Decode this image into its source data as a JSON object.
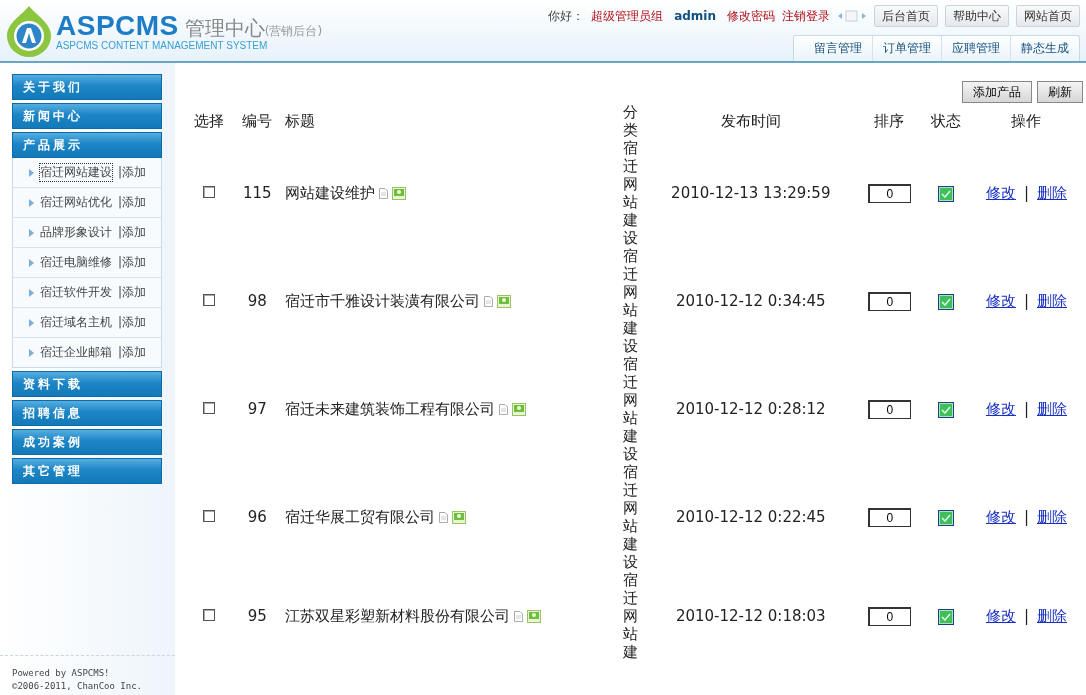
{
  "header": {
    "logo": {
      "name": "ASPCMS",
      "title": "管理中心",
      "subtitle": "(营销后台)",
      "tagline": "ASPCMS CONTENT MANAGEMENT SYSTEM"
    },
    "greeting": "你好：",
    "group": "超级管理员组",
    "username": "admin",
    "links": [
      "修改密码",
      "注销登录"
    ],
    "buttons": [
      "后台首页",
      "帮助中心",
      "网站首页"
    ],
    "tabs": [
      "留言管理",
      "订单管理",
      "应聘管理",
      "静态生成"
    ]
  },
  "sidebar": {
    "sections": [
      {
        "label": "关于我们"
      },
      {
        "label": "新闻中心"
      },
      {
        "label": "产品展示",
        "children": [
          {
            "label": "宿迁网站建设",
            "action": "|添加",
            "selected": true
          },
          {
            "label": "宿迁网站优化",
            "action": "|添加",
            "selected": false
          },
          {
            "label": "品牌形象设计",
            "action": "|添加",
            "selected": false
          },
          {
            "label": "宿迁电脑维修",
            "action": "|添加",
            "selected": false
          },
          {
            "label": "宿迁软件开发",
            "action": "|添加",
            "selected": false
          },
          {
            "label": "宿迁域名主机",
            "action": "|添加",
            "selected": false
          },
          {
            "label": "宿迁企业邮箱",
            "action": "|添加",
            "selected": false
          }
        ]
      },
      {
        "label": "资料下载"
      },
      {
        "label": "招聘信息"
      },
      {
        "label": "成功案例"
      },
      {
        "label": "其它管理"
      }
    ],
    "footer": [
      "Powered by ASPCMS!",
      "©2006-2011, ChanCoo Inc."
    ]
  },
  "toolbar": {
    "buttons": [
      "添加产品",
      "刷新"
    ]
  },
  "table": {
    "action_separator": "|",
    "columns": [
      "选择",
      "编号",
      "标题",
      "分类",
      "发布时间",
      "排序",
      "状态",
      "操作"
    ],
    "rows": [
      {
        "checked": false,
        "id": "115",
        "title": "网站建设维护",
        "category": "宿迁网站建设",
        "time": "2010-12-13 13:29:59",
        "order": "0",
        "enabled": true,
        "actions": [
          "修改",
          "删除"
        ]
      },
      {
        "checked": false,
        "id": "98",
        "title": "宿迁市千雅设计装潢有限公司",
        "category": "宿迁网站建设",
        "time": "2010-12-12 0:34:45",
        "order": "0",
        "enabled": true,
        "actions": [
          "修改",
          "删除"
        ]
      },
      {
        "checked": false,
        "id": "97",
        "title": "宿迁未来建筑装饰工程有限公司",
        "category": "宿迁网站建设",
        "time": "2010-12-12 0:28:12",
        "order": "0",
        "enabled": true,
        "actions": [
          "修改",
          "删除"
        ]
      },
      {
        "checked": false,
        "id": "96",
        "title": "宿迁华展工贸有限公司",
        "category": "宿迁网站建设",
        "time": "2010-12-12 0:22:45",
        "order": "0",
        "enabled": true,
        "actions": [
          "修改",
          "删除"
        ]
      },
      {
        "checked": false,
        "id": "95",
        "title": "江苏双星彩塑新材料股份有限公司",
        "category": "宿迁网站建",
        "time": "2010-12-12 0:18:03",
        "order": "0",
        "enabled": true,
        "actions": [
          "修改",
          "删除"
        ]
      }
    ]
  }
}
